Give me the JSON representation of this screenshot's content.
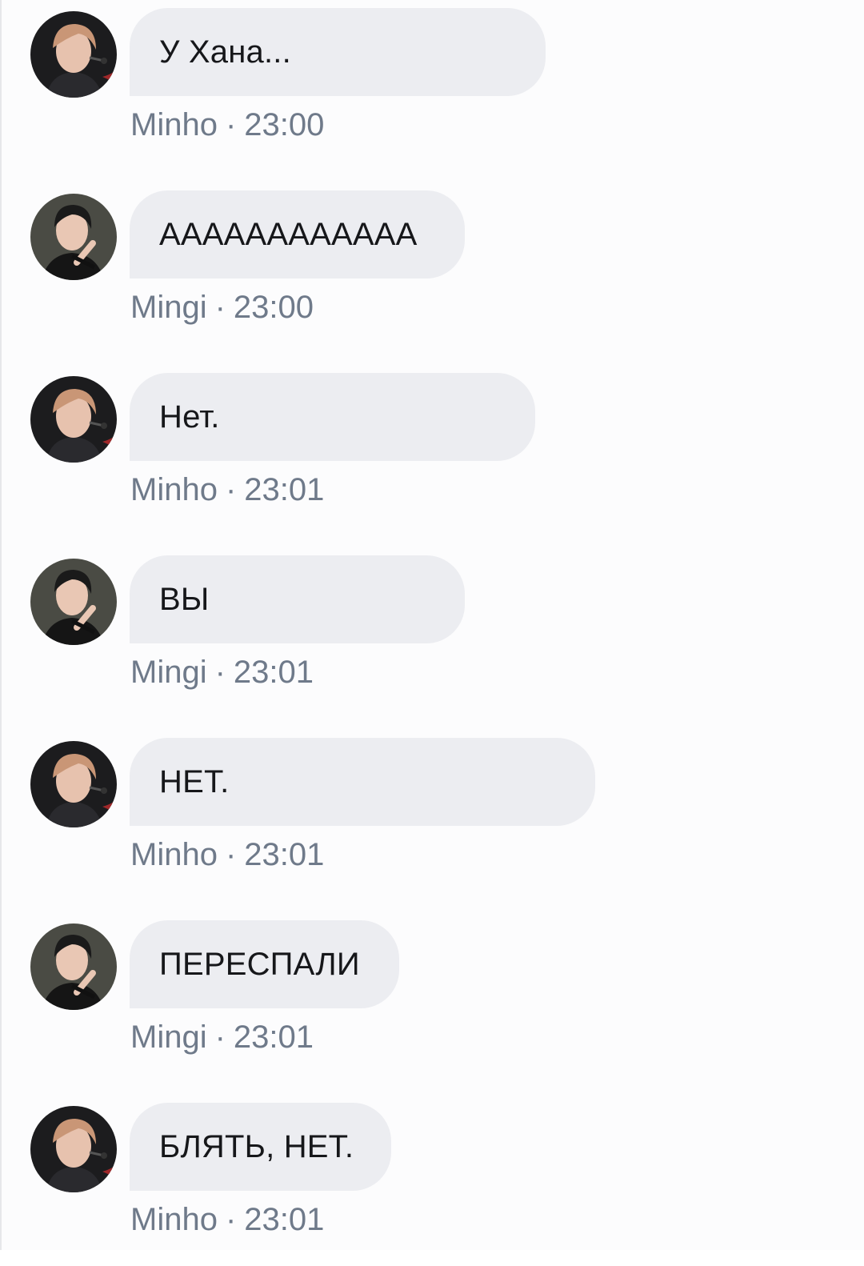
{
  "messages": [
    {
      "text": "У Хана...",
      "author": "Minho",
      "time": "23:00",
      "avatar": "minho-avatar"
    },
    {
      "text": "АААААААААААА",
      "author": "Mingi",
      "time": "23:00",
      "avatar": "mingi-avatar"
    },
    {
      "text": "Нет.",
      "author": "Minho",
      "time": "23:01",
      "avatar": "minho-avatar"
    },
    {
      "text": "ВЫ",
      "author": "Mingi",
      "time": "23:01",
      "avatar": "mingi-avatar"
    },
    {
      "text": "НЕТ.",
      "author": "Minho",
      "time": "23:01",
      "avatar": "minho-avatar"
    },
    {
      "text": "ПЕРЕСПАЛИ",
      "author": "Mingi",
      "time": "23:01",
      "avatar": "mingi-avatar"
    },
    {
      "text": "БЛЯТЬ, НЕТ.",
      "author": "Minho",
      "time": "23:01",
      "avatar": "minho-avatar"
    }
  ],
  "meta_separator": "·",
  "colors": {
    "bubble": "#ecedf1",
    "meta_text": "#6f7a8a",
    "message_text": "#16171a"
  }
}
